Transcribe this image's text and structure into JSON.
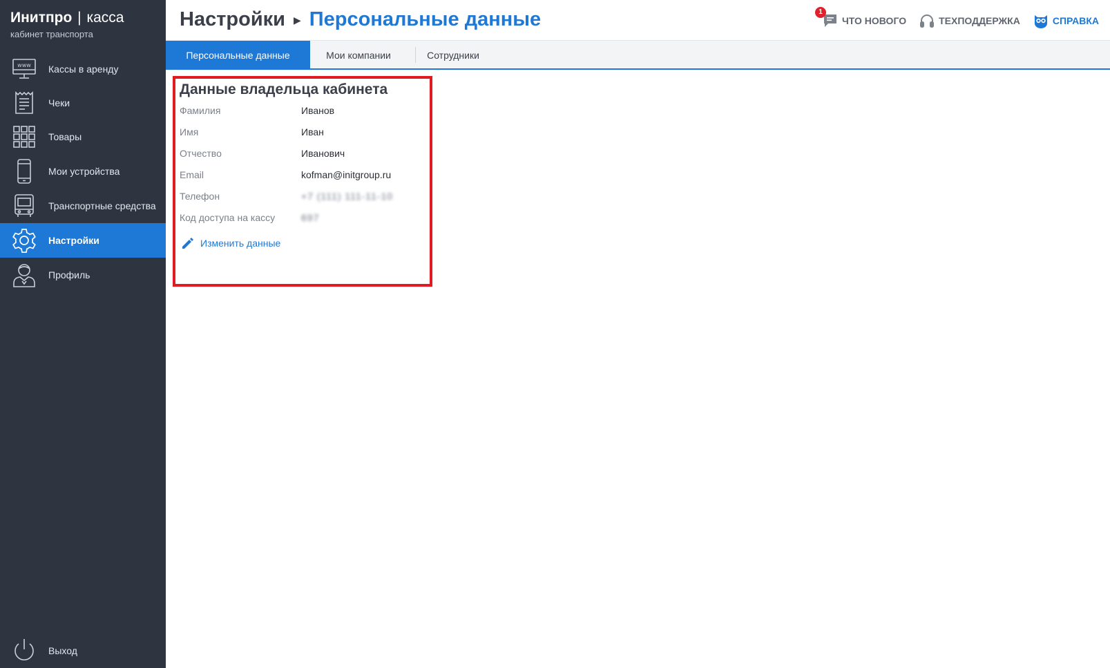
{
  "brand": {
    "name_bold": "Инитпро",
    "separator": "|",
    "name_light": "касса",
    "subtitle": "кабинет транспорта"
  },
  "sidebar": {
    "items": [
      {
        "label": "Кассы в аренду",
        "icon": "www-monitor-icon"
      },
      {
        "label": "Чеки",
        "icon": "receipt-icon"
      },
      {
        "label": "Товары",
        "icon": "grid-icon"
      },
      {
        "label": "Мои устройства",
        "icon": "phone-icon"
      },
      {
        "label": "Транспортные средства",
        "icon": "bus-icon"
      },
      {
        "label": "Настройки",
        "icon": "gear-icon",
        "active": true
      },
      {
        "label": "Профиль",
        "icon": "user-icon"
      }
    ],
    "logout_label": "Выход"
  },
  "header": {
    "breadcrumb_parent": "Настройки",
    "breadcrumb_current": "Персональные данные",
    "whats_new": {
      "label": "ЧТО НОВОГО",
      "badge": "1"
    },
    "support_label": "ТЕХПОДДЕРЖКА",
    "help_label": "СПРАВКА"
  },
  "tabs": [
    {
      "label": "Персональные данные",
      "active": true
    },
    {
      "label": "Мои компании"
    },
    {
      "label": "Сотрудники"
    }
  ],
  "owner_card": {
    "title": "Данные владельца кабинета",
    "fields": [
      {
        "label": "Фамилия",
        "value": "Иванов"
      },
      {
        "label": "Имя",
        "value": "Иван"
      },
      {
        "label": "Отчество",
        "value": "Иванович"
      },
      {
        "label": "Email",
        "value": "kofman@initgroup.ru"
      },
      {
        "label": "Телефон",
        "value": "+7 (111) 111-11-10"
      },
      {
        "label": "Код доступа на кассу",
        "value": "697"
      }
    ],
    "edit_label": "Изменить данные"
  },
  "colors": {
    "sidebar_bg": "#2f3441",
    "accent": "#1e78d6",
    "highlight_border": "#e11b22",
    "badge": "#e0202b"
  }
}
